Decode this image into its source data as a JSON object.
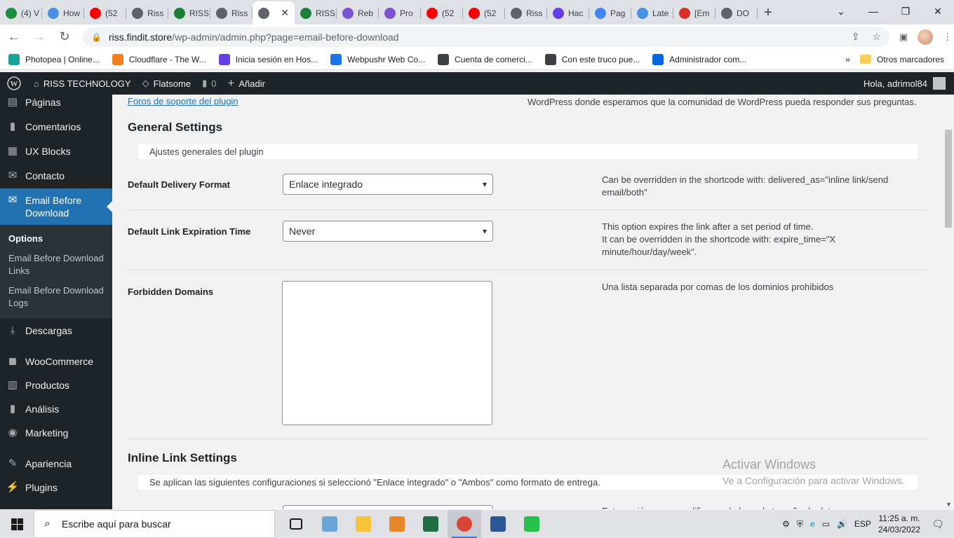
{
  "browser": {
    "tabs": [
      {
        "label": "(4) V",
        "fav": "#1e8e3e"
      },
      {
        "label": "How",
        "fav": "#4a90e2"
      },
      {
        "label": "(52",
        "fav": "#ff0000"
      },
      {
        "label": "Riss",
        "fav": "#5f6368"
      },
      {
        "label": "RISS",
        "fav": "#188038"
      },
      {
        "label": "Riss",
        "fav": "#5f6368"
      },
      {
        "label": "",
        "fav": "#5f6368",
        "active": true
      },
      {
        "label": "RISS",
        "fav": "#188038"
      },
      {
        "label": "Reb",
        "fav": "#7b52d1"
      },
      {
        "label": "Pro",
        "fav": "#7b52d1"
      },
      {
        "label": "(52",
        "fav": "#ff0000"
      },
      {
        "label": "(52",
        "fav": "#ff0000"
      },
      {
        "label": "Riss",
        "fav": "#5f6368"
      },
      {
        "label": "Hac",
        "fav": "#673de6"
      },
      {
        "label": "Pag",
        "fav": "#4285f4"
      },
      {
        "label": "Late",
        "fav": "#4a90e2"
      },
      {
        "label": "[Em",
        "fav": "#d93025"
      },
      {
        "label": "DO",
        "fav": "#5f6368"
      }
    ],
    "new_tab": "+",
    "url_host": "riss.findit.store",
    "url_path": "/wp-admin/admin.php?page=email-before-download",
    "bookmarks": [
      {
        "label": "Photopea | Online...",
        "fav": "#18a497"
      },
      {
        "label": "Cloudflare - The W...",
        "fav": "#f38020"
      },
      {
        "label": "Inicia sesión en Hos...",
        "fav": "#673de6"
      },
      {
        "label": "Webpushr Web Co...",
        "fav": "#1a73e8"
      },
      {
        "label": "Cuenta de comerci...",
        "fav": "#3c4043"
      },
      {
        "label": "Con este truco pue...",
        "fav": "#3c4043"
      },
      {
        "label": "Administrador com...",
        "fav": "#0668e1"
      }
    ],
    "more_bookmarks": "»",
    "other_bookmarks": "Otros marcadores"
  },
  "adminbar": {
    "site_name": "RISS TECHNOLOGY",
    "theme": "Flatsome",
    "comments_count": "0",
    "add_new": "Añadir",
    "greeting": "Hola, adrimol84"
  },
  "sidebar": {
    "items_top": [
      {
        "label": "Páginas",
        "icon": "pages-icon"
      },
      {
        "label": "Comentarios",
        "icon": "comments-icon"
      },
      {
        "label": "UX Blocks",
        "icon": "blocks-icon"
      },
      {
        "label": "Contacto",
        "icon": "mail-icon"
      }
    ],
    "current": {
      "label": "Email Before Download",
      "icon": "email-icon"
    },
    "submenu": [
      {
        "label": "Options",
        "current": true
      },
      {
        "label": "Email Before Download Links"
      },
      {
        "label": "Email Before Download Logs"
      }
    ],
    "items_bottom": [
      {
        "label": "Descargas",
        "icon": "download-icon"
      },
      {
        "label": "WooCommerce",
        "icon": "woo-icon"
      },
      {
        "label": "Productos",
        "icon": "products-icon"
      },
      {
        "label": "Análisis",
        "icon": "analytics-icon"
      },
      {
        "label": "Marketing",
        "icon": "marketing-icon"
      },
      {
        "label": "Apariencia",
        "icon": "appearance-icon"
      },
      {
        "label": "Plugins",
        "icon": "plugins-icon"
      }
    ]
  },
  "main": {
    "support_link": "Foros de soporte del plugin",
    "support_text": "WordPress donde esperamos que la comunidad de WordPress pueda responder sus preguntas.",
    "general": {
      "title": "General Settings",
      "description": "Ajustes generales del plugin",
      "delivery_label": "Default Delivery Format",
      "delivery_value": "Enlace integrado",
      "delivery_help": "Can be overridden in the shortcode with: delivered_as=\"inline link/send email/both\"",
      "expiration_label": "Default Link Expiration Time",
      "expiration_value": "Never",
      "expiration_help_1": "This option expires the link after a set period of time.",
      "expiration_help_2": "It can be overridden in the shortcode with: expire_time=\"X minute/hour/day/week\".",
      "forbidden_label": "Forbidden Domains",
      "forbidden_help": "Una lista separada por comas de los dominios prohibidos"
    },
    "inline": {
      "title": "Inline Link Settings",
      "description": "Se aplican las siguientes configuraciones si seleccionó \"Enlace integrado\" o \"Ambos\" como formato de entrega.",
      "partial_help": "Esta opción no se modificara a la hora de tamaño de dato"
    },
    "watermark": {
      "line1": "Activar Windows",
      "line2": "Ve a Configuración para activar Windows."
    }
  },
  "taskbar": {
    "search_placeholder": "Escribe aquí para buscar",
    "apps": [
      {
        "name": "task-view",
        "color": "#1a1a1a"
      },
      {
        "name": "notes",
        "color": "#6aa7d8"
      },
      {
        "name": "file-explorer",
        "color": "#f8c13a"
      },
      {
        "name": "wps-writer",
        "color": "#e8862a"
      },
      {
        "name": "excel",
        "color": "#1d6f42"
      },
      {
        "name": "chrome",
        "color": "#db4437",
        "active": true
      },
      {
        "name": "word",
        "color": "#2b579a"
      },
      {
        "name": "pen-app",
        "color": "#27c24c"
      }
    ],
    "language": "ESP",
    "time": "11:25 a. m.",
    "date": "24/03/2022"
  }
}
